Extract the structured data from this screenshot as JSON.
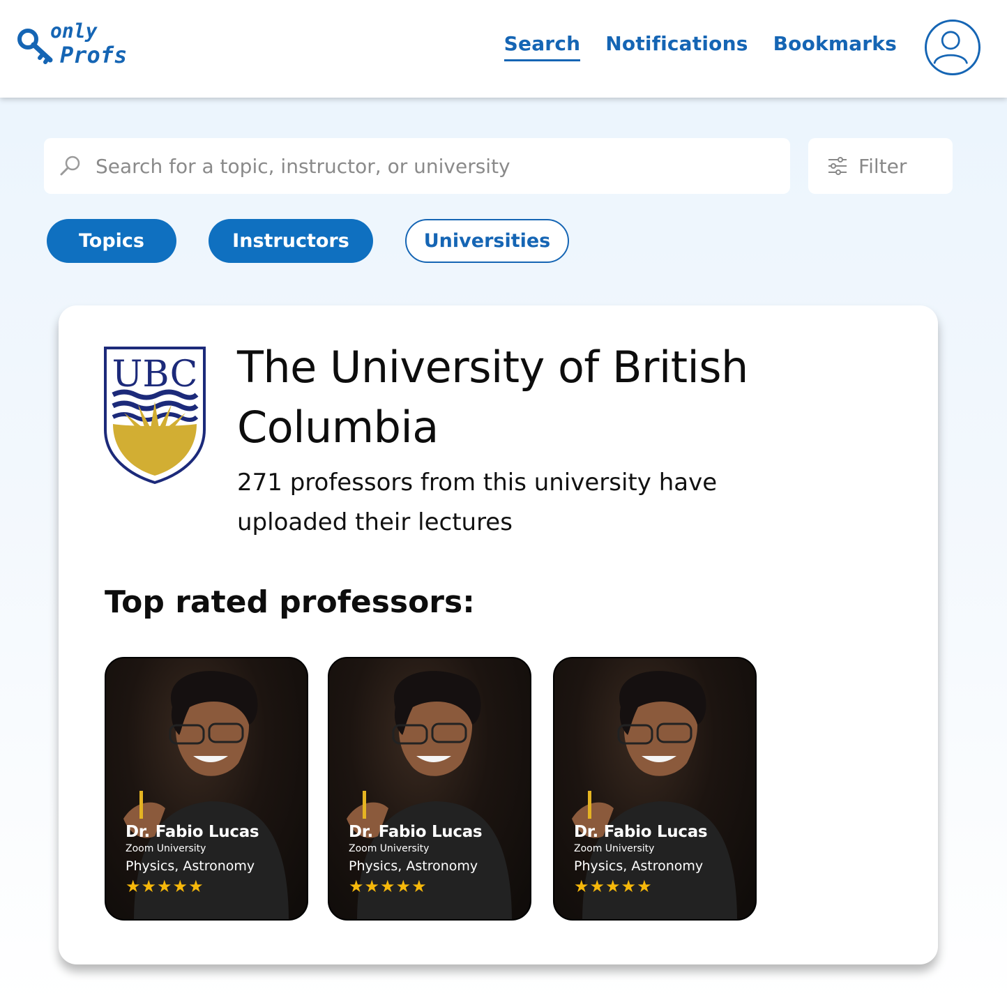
{
  "logo": {
    "line1": "only",
    "line2": "Profs"
  },
  "nav": {
    "search": "Search",
    "notifications": "Notifications",
    "bookmarks": "Bookmarks"
  },
  "search": {
    "placeholder": "Search for a topic, instructor, or university",
    "value": ""
  },
  "filter": {
    "label": "Filter"
  },
  "tabs": {
    "topics": "Topics",
    "instructors": "Instructors",
    "universities": "Universities",
    "active": "universities"
  },
  "university": {
    "crest_text": "UBC",
    "name": "The University of British Columbia",
    "description": "271 professors from this university have uploaded their lectures",
    "top_heading": "Top rated professors:"
  },
  "professors": [
    {
      "name": "Dr. Fabio Lucas",
      "university": "Zoom University",
      "subjects": "Physics, Astronomy",
      "stars": "★★★★★",
      "rating": 5
    },
    {
      "name": "Dr. Fabio Lucas",
      "university": "Zoom University",
      "subjects": "Physics, Astronomy",
      "stars": "★★★★★",
      "rating": 5
    },
    {
      "name": "Dr. Fabio Lucas",
      "university": "Zoom University",
      "subjects": "Physics, Astronomy",
      "stars": "★★★★★",
      "rating": 5
    }
  ],
  "colors": {
    "brand": "#1565b4",
    "tab_fill": "#0f70c0",
    "star": "#f6b80b",
    "crest_navy": "#1c2a7a",
    "crest_gold": "#d2ae33"
  },
  "icons": {
    "logo": "key-icon",
    "avatar": "user-icon",
    "search": "search-icon",
    "filter": "sliders-icon"
  }
}
